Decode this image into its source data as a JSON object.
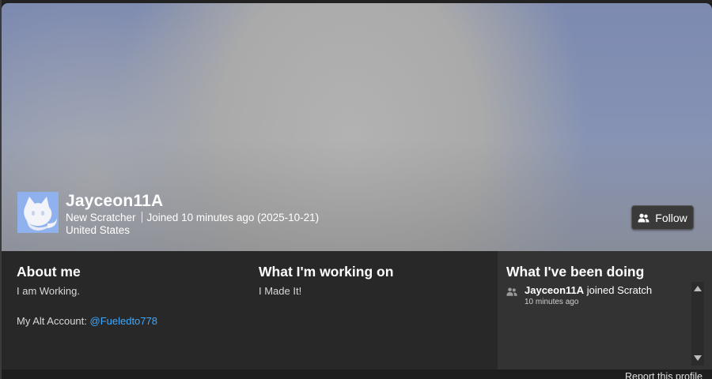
{
  "profile": {
    "username": "Jayceon11A",
    "rank": "New Scratcher",
    "joined": "Joined 10 minutes ago (2025-10-21)",
    "location": "United States",
    "follow_label": "Follow"
  },
  "about": {
    "heading": "About me",
    "line1": "I am Working.",
    "alt_prefix": "My Alt Account: ",
    "alt_link": "@Fueledto778"
  },
  "working": {
    "heading": "What I'm working on",
    "line1": "I Made It!"
  },
  "activity": {
    "heading": "What I've been doing",
    "items": [
      {
        "user": "Jayceon11A",
        "action": " joined Scratch",
        "time": "10 minutes ago"
      }
    ]
  },
  "footer": {
    "report_label": "Report this profile"
  },
  "colors": {
    "link": "#3fa9ff",
    "panel": "#282828",
    "activity_panel": "#333333"
  },
  "icons": {
    "follow": "follow-users-icon",
    "activity": "users-icon",
    "avatar": "scratch-cat-avatar"
  }
}
